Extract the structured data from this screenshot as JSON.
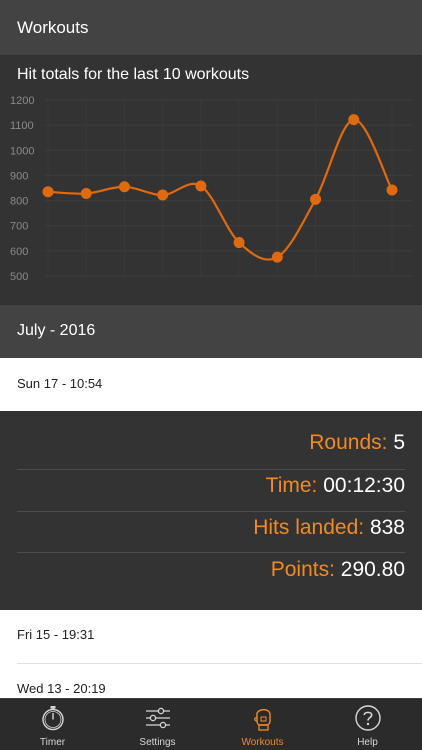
{
  "header": {
    "title": "Workouts"
  },
  "chart_title": "Hit totals for the last 10 workouts",
  "chart_data": {
    "type": "line",
    "title": "Hit totals for the last 10 workouts",
    "x": [
      1,
      2,
      3,
      4,
      5,
      6,
      7,
      8,
      9,
      10
    ],
    "series": [
      {
        "values": [
          835,
          828,
          855,
          822,
          858,
          633,
          575,
          805,
          1122,
          842
        ]
      }
    ],
    "ylim": [
      500,
      1200
    ],
    "yticks": [
      500,
      600,
      700,
      800,
      900,
      1000,
      1100,
      1200
    ],
    "grid": true,
    "color": "#e06a10"
  },
  "section": {
    "month_label": "July - 2016"
  },
  "workouts": [
    {
      "label": "Sun 17 - 10:54"
    },
    {
      "label": "Fri 15 - 19:31"
    },
    {
      "label": "Wed 13 - 20:19"
    }
  ],
  "details": {
    "rounds": {
      "key": "Rounds:",
      "value": "5"
    },
    "time": {
      "key": "Time:",
      "value": "00:12:30"
    },
    "hits": {
      "key": "Hits landed:",
      "value": "838"
    },
    "points": {
      "key": "Points:",
      "value": "290.80"
    }
  },
  "tabs": [
    {
      "label": "Timer",
      "icon": "stopwatch-icon"
    },
    {
      "label": "Settings",
      "icon": "sliders-icon"
    },
    {
      "label": "Workouts",
      "icon": "boxing-glove-icon"
    },
    {
      "label": "Help",
      "icon": "help-icon"
    }
  ],
  "colors": {
    "accent": "#f08a24",
    "line": "#e06a10",
    "panel": "#333333",
    "bar": "#434343"
  }
}
